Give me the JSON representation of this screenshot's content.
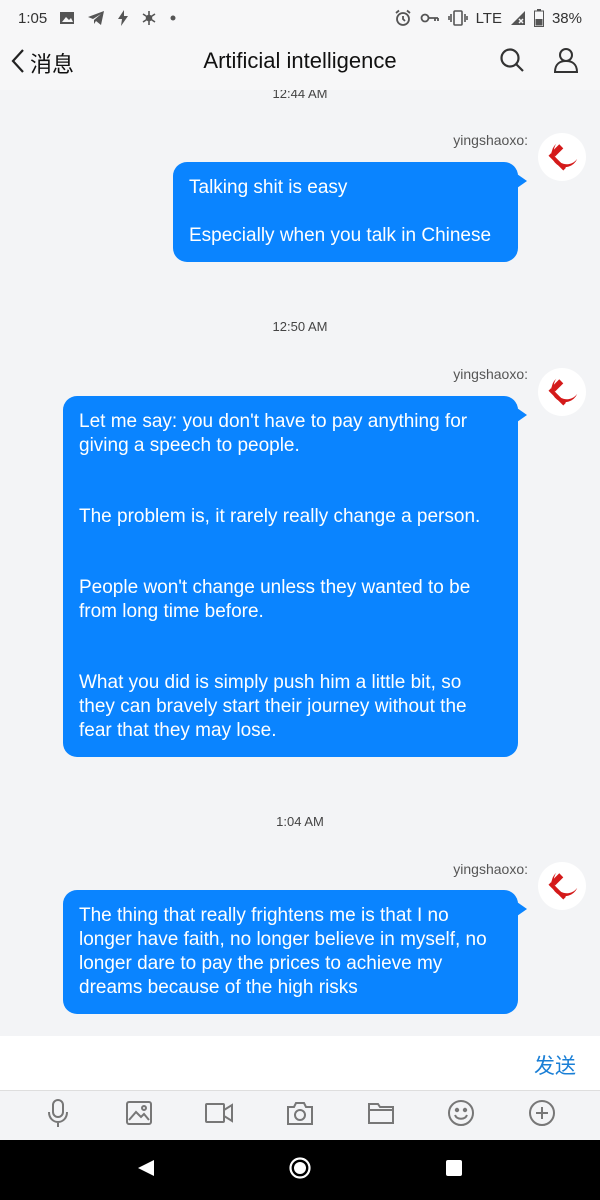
{
  "status_bar": {
    "time": "1:05",
    "network": "LTE",
    "battery": "38%",
    "left_icons": [
      "image-icon",
      "telegram-icon",
      "bolt-icon",
      "snowflake-icon",
      "dot-icon"
    ],
    "right_icons": [
      "alarm-icon",
      "key-icon",
      "vibrate-icon",
      "signal-icon",
      "battery-icon"
    ]
  },
  "header": {
    "back_label": "消息",
    "title": "Artificial intelligence",
    "actions": [
      "search-icon",
      "contact-icon"
    ]
  },
  "chat": {
    "top_timestamp": "12:44 AM",
    "groups": [
      {
        "sender": "yingshaoxo:",
        "paragraphs": [
          "Talking shit is easy",
          "Especially when you talk in Chinese"
        ]
      },
      {
        "timestamp": "12:50 AM",
        "sender": "yingshaoxo:",
        "paragraphs": [
          "Let me say: you don't have to pay anything for giving a speech to people.",
          "The problem is, it rarely really change a person.",
          "People won't change unless they wanted to be from long time before.",
          "What you did is simply push him a little bit, so they can bravely start their journey without the fear that they may lose."
        ]
      },
      {
        "timestamp": "1:04 AM",
        "sender": "yingshaoxo:",
        "paragraphs": [
          "The thing that really frightens me is that I no longer have faith, no longer believe in myself, no longer dare to pay the prices to achieve my dreams because of the high risks"
        ]
      }
    ]
  },
  "input": {
    "send_label": "发送"
  },
  "toolbar": {
    "icons": [
      "microphone-icon",
      "image-icon",
      "video-icon",
      "camera-icon",
      "folder-icon",
      "emoji-icon",
      "plus-icon"
    ]
  },
  "navbar": {
    "icons": [
      "back-triangle-icon",
      "home-circle-icon",
      "recents-square-icon"
    ]
  },
  "colors": {
    "bubble": "#0a84ff",
    "send": "#1a7fd6",
    "avatar_emblem": "#d41a1a",
    "background": "#f3f4f6"
  }
}
